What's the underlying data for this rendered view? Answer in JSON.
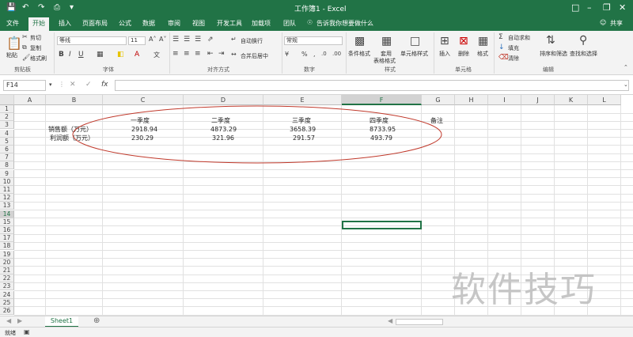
{
  "titlebar": {
    "title": "工作簿1 - Excel",
    "undo_icon": "undo-icon",
    "redo_icon": "redo-icon",
    "save_icon": "save-icon"
  },
  "tabs": [
    "文件",
    "开始",
    "插入",
    "页面布局",
    "公式",
    "数据",
    "审阅",
    "视图",
    "开发工具",
    "加载项",
    "团队"
  ],
  "active_tab": "开始",
  "tell_me": "告诉我你想要做什么",
  "share": "共享",
  "ribbon": {
    "clipboard": {
      "paste": "粘贴",
      "cut": "剪切",
      "copy": "复制",
      "format_painter": "格式刷",
      "group": "剪贴板"
    },
    "font": {
      "font_name": "等线",
      "font_size": "11",
      "group": "字体"
    },
    "alignment": {
      "wrap": "自动换行",
      "merge": "合并后居中",
      "group": "对齐方式"
    },
    "number": {
      "format": "常规",
      "group": "数字"
    },
    "styles": {
      "conditional": "条件格式",
      "table": "套用\n表格格式",
      "table_l1": "套用",
      "table_l2": "表格格式",
      "cell_styles": "单元格样式",
      "group": "样式"
    },
    "cells": {
      "insert": "插入",
      "delete": "删除",
      "format": "格式",
      "group": "单元格"
    },
    "editing": {
      "autosum": "自动求和",
      "fill": "填充",
      "clear": "清除",
      "sort": "排序和筛选",
      "find": "查找和选择",
      "group": "编辑"
    }
  },
  "namebox": "F14",
  "columns": [
    "A",
    "B",
    "C",
    "D",
    "E",
    "F",
    "G",
    "H",
    "I",
    "J",
    "K",
    "L"
  ],
  "selected_column": "F",
  "rows": [
    "1",
    "2",
    "3",
    "4",
    "5",
    "6",
    "7",
    "8",
    "9",
    "10",
    "11",
    "12",
    "13",
    "14",
    "15",
    "16",
    "17",
    "18",
    "19",
    "20",
    "21",
    "22",
    "23",
    "24",
    "25",
    "26"
  ],
  "selected_row": "14",
  "cells": {
    "C2": "一季度",
    "D2": "二季度",
    "E2": "三季度",
    "F2": "四季度",
    "G2": "备注",
    "B3": "销售额（万元）",
    "C3": "2918.94",
    "D3": "4873.29",
    "E3": "3658.39",
    "F3": "8733.95",
    "B4": "利润额（万元）",
    "C4": "230.29",
    "D4": "321.96",
    "E4": "291.57",
    "F4": "493.79"
  },
  "sheet_tab": "Sheet1",
  "status": "就绪",
  "watermark": "软件技巧",
  "colors": {
    "accent": "#217346",
    "annotation": "#c0392b"
  }
}
